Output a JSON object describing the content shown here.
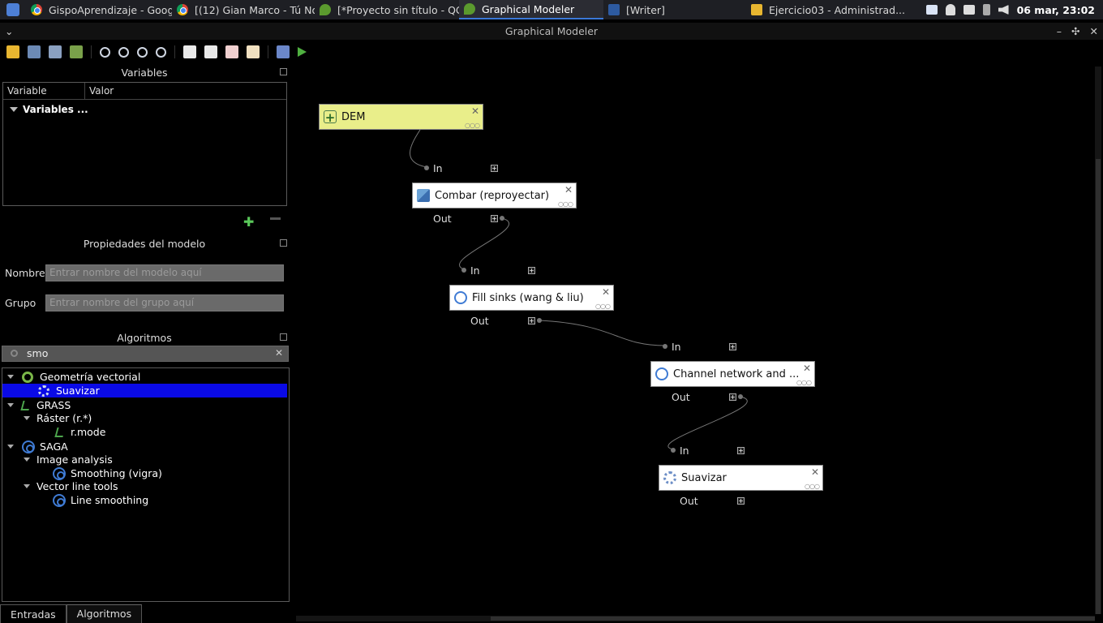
{
  "taskbar": {
    "tasks": [
      {
        "label": "GispoAprendizaje - Goog...",
        "icon": "chrome-icon"
      },
      {
        "label": "[(12) Gian Marco - Tú No ...",
        "icon": "chrome-icon"
      },
      {
        "label": "[*Proyecto sin título - QG...",
        "icon": "qgis-icon"
      },
      {
        "label": "Graphical Modeler",
        "icon": "qgis-icon",
        "active": true
      },
      {
        "label": "[Writer]",
        "icon": "writer-icon"
      },
      {
        "label": "Ejercicio03 - Administrad...",
        "icon": "folder-icon"
      }
    ],
    "clock": "06 mar, 23:02"
  },
  "window": {
    "title": "Graphical Modeler"
  },
  "variables_panel": {
    "title": "Variables",
    "col_variable": "Variable",
    "col_valor": "Valor",
    "root_item": "Variables ..."
  },
  "model_props": {
    "title": "Propiedades del modelo",
    "name_label": "Nombre",
    "name_placeholder": "Entrar nombre del modelo aquí",
    "group_label": "Grupo",
    "group_placeholder": "Entrar nombre del grupo aquí"
  },
  "algorithms_panel": {
    "title": "Algoritmos",
    "search_value": "smo",
    "tree": {
      "vector_geometry": "Geometría vectorial",
      "suavizar": "Suavizar",
      "grass": "GRASS",
      "raster": "Ráster (r.*)",
      "rmode": "r.mode",
      "saga": "SAGA",
      "image_analysis": "Image analysis",
      "smoothing_vigra": "Smoothing (vigra)",
      "vector_line_tools": "Vector line tools",
      "line_smoothing": "Line smoothing"
    }
  },
  "bottom_tabs": {
    "entradas": "Entradas",
    "algoritmos": "Algoritmos"
  },
  "canvas": {
    "dem": "DEM",
    "combar": "Combar (reproyectar)",
    "fill_sinks": "Fill sinks (wang & liu)",
    "channel": "Channel network and ...",
    "suavizar": "Suavizar",
    "in_label": "In",
    "out_label": "Out"
  },
  "colors": {
    "selection": "#0a0ae6",
    "input_node": "#e9ee8a",
    "run": "#4fb040"
  }
}
